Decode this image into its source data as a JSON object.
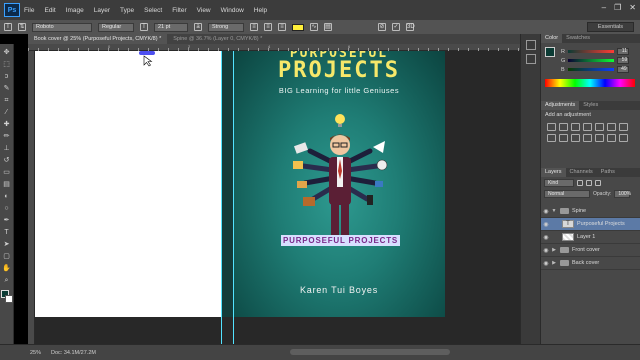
{
  "app": {
    "logo": "Ps"
  },
  "menu": [
    "File",
    "Edit",
    "Image",
    "Layer",
    "Type",
    "Select",
    "Filter",
    "View",
    "Window",
    "Help"
  ],
  "options": {
    "font_family": "Roboto",
    "font_style": "Regular",
    "font_size": "21 pt",
    "antialias": "Strong",
    "text_color": "#ffef3a",
    "workspace": "Essentials"
  },
  "tabs": [
    {
      "label": "Book cover @ 25% (Purposeful Projects, CMYK/8) *",
      "active": true
    },
    {
      "label": "Spine @ 36.7% (Layer 0, CMYK/8) *",
      "active": false
    }
  ],
  "ruler_labels": [
    "0",
    "2",
    "4",
    "6"
  ],
  "tools": [
    "move",
    "marquee",
    "lasso",
    "quick-select",
    "crop",
    "eyedropper",
    "healing",
    "brush",
    "stamp",
    "history-brush",
    "eraser",
    "gradient",
    "blur",
    "dodge",
    "pen",
    "type",
    "path-select",
    "shape",
    "hand",
    "zoom"
  ],
  "fg_color": "#0b3b34",
  "bg_color": "#ffffff",
  "cover": {
    "heading_top": "PURPOSEFUL",
    "heading": "PROJECTS",
    "tagline": "BIG Learning for little Geniuses",
    "label": "PURPOSEFUL PROJECTS",
    "author": "Karen Tui Boyes"
  },
  "color_panel": {
    "tabs": [
      "Color",
      "Swatches"
    ],
    "channels": [
      {
        "label": "R",
        "value": "11"
      },
      {
        "label": "G",
        "value": "59"
      },
      {
        "label": "B",
        "value": "49"
      }
    ]
  },
  "adjustments": {
    "tabs": [
      "Adjustments",
      "Styles"
    ],
    "heading": "Add an adjustment"
  },
  "layers_panel": {
    "tabs": [
      "Layers",
      "Channels",
      "Paths"
    ],
    "kind": "Kind",
    "blend_mode": "Normal",
    "opacity_label": "Opacity:",
    "opacity_value": "100%",
    "layers": [
      {
        "name": "Spine",
        "type": "group",
        "expanded": true,
        "selected": false,
        "depth": 0
      },
      {
        "name": "Purposeful Projects",
        "type": "text",
        "selected": true,
        "depth": 1
      },
      {
        "name": "Layer 1",
        "type": "image",
        "selected": false,
        "depth": 1
      },
      {
        "name": "Front cover",
        "type": "group",
        "expanded": false,
        "selected": false,
        "depth": 0
      },
      {
        "name": "Back cover",
        "type": "group",
        "expanded": false,
        "selected": false,
        "depth": 0
      }
    ]
  },
  "status": {
    "zoom": "25%",
    "doc": "Doc: 34.1M/27.2M"
  }
}
